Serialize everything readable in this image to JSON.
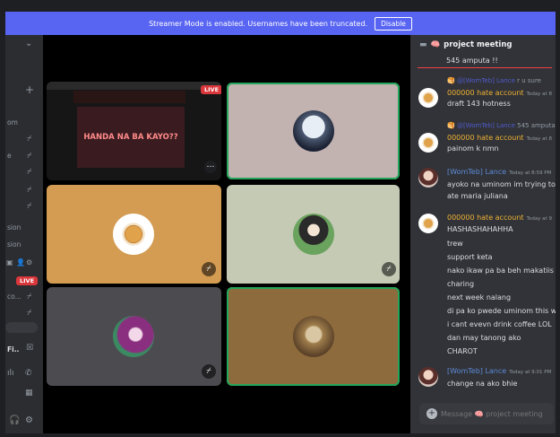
{
  "banner": {
    "text": "Streamer Mode is enabled. Usernames have been truncated.",
    "button": "Disable"
  },
  "sidebar": {
    "labels": [
      "om",
      "e",
      "sion",
      "sion",
      "LIVE",
      "co...",
      "Fi.."
    ]
  },
  "stage": {
    "screenshare_title": "HANDA NA BA KAYO??",
    "live_badge": "LIVE"
  },
  "chat": {
    "channel_emoji": "🧠",
    "channel": "project meeting",
    "top_text": "545 amputa !!",
    "messages": [
      {
        "reply_name": "@[WomTeb] Lance",
        "reply_text": "r u sure",
        "name": "000000 hate account",
        "time": "Today at 8",
        "lines": [
          "draft 143 hotness"
        ],
        "name_color": "#f0b232"
      },
      {
        "reply_name": "@[WomTeb] Lance",
        "reply_text": "545 amputa",
        "name": "000000 hate account",
        "time": "Today at 8",
        "lines": [
          "painom k nmn"
        ],
        "name_color": "#f0b232"
      },
      {
        "name": "[WomTeb] Lance",
        "time": "Today at 8:59 PM",
        "lines": [
          "ayoko na uminom im trying to b",
          "ate maria juliana"
        ],
        "name_color": "#5e8ad6"
      },
      {
        "name": "000000 hate account",
        "time": "Today at 9",
        "lines": [
          "HASHASHAHAHHA",
          "trew",
          "support keta",
          "nako ikaw pa ba beh makatiis s",
          "charing",
          "next week nalang",
          "di pa ko pwede uminom this we",
          "i cant evevn drink coffee LOL",
          "dan may tanong ako",
          "CHAROT"
        ],
        "name_color": "#f0b232"
      },
      {
        "name": "[WomTeb] Lance",
        "time": "Today at 9:01 PM",
        "lines": [
          "change na ako bhie"
        ],
        "name_color": "#5e8ad6"
      }
    ],
    "compose_placeholder": "Message 🧠 project meeting"
  },
  "colors": {
    "accent": "#5865f2",
    "speaking": "#23a55a",
    "live": "#da373c"
  }
}
